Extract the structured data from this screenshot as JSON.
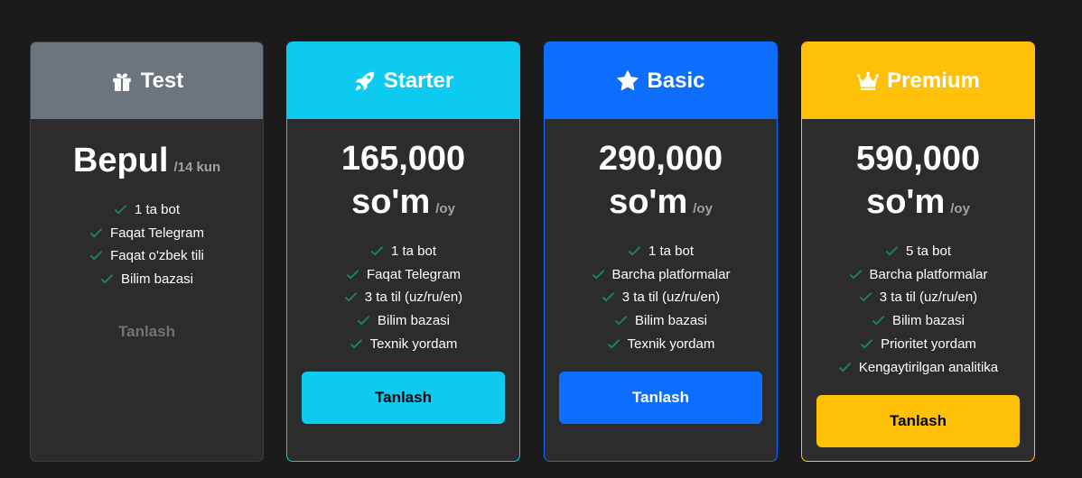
{
  "colors": {
    "test": "#6c757d",
    "starter": "#0dcaf0",
    "basic": "#0d6efd",
    "premium": "#ffc107",
    "check": "#198754"
  },
  "plans": [
    {
      "name": "Test",
      "icon": "gift-icon",
      "price": "Bepul",
      "price_line2": "",
      "period": "/14 kun",
      "features": [
        "1 ta bot",
        "Faqat Telegram",
        "Faqat o'zbek tili",
        "Bilim bazasi"
      ],
      "button": "Tanlash"
    },
    {
      "name": "Starter",
      "icon": "rocket-icon",
      "price": "165,000",
      "price_line2": "so'm",
      "period": "/oy",
      "features": [
        "1 ta bot",
        "Faqat Telegram",
        "3 ta til (uz/ru/en)",
        "Bilim bazasi",
        "Texnik yordam"
      ],
      "button": "Tanlash"
    },
    {
      "name": "Basic",
      "icon": "star-icon",
      "price": "290,000",
      "price_line2": "so'm",
      "period": "/oy",
      "features": [
        "1 ta bot",
        "Barcha platformalar",
        "3 ta til (uz/ru/en)",
        "Bilim bazasi",
        "Texnik yordam"
      ],
      "button": "Tanlash"
    },
    {
      "name": "Premium",
      "icon": "crown-icon",
      "price": "590,000",
      "price_line2": "so'm",
      "period": "/oy",
      "features": [
        "5 ta bot",
        "Barcha platformalar",
        "3 ta til (uz/ru/en)",
        "Bilim bazasi",
        "Prioritet yordam",
        "Kengaytirilgan analitika"
      ],
      "button": "Tanlash"
    }
  ]
}
